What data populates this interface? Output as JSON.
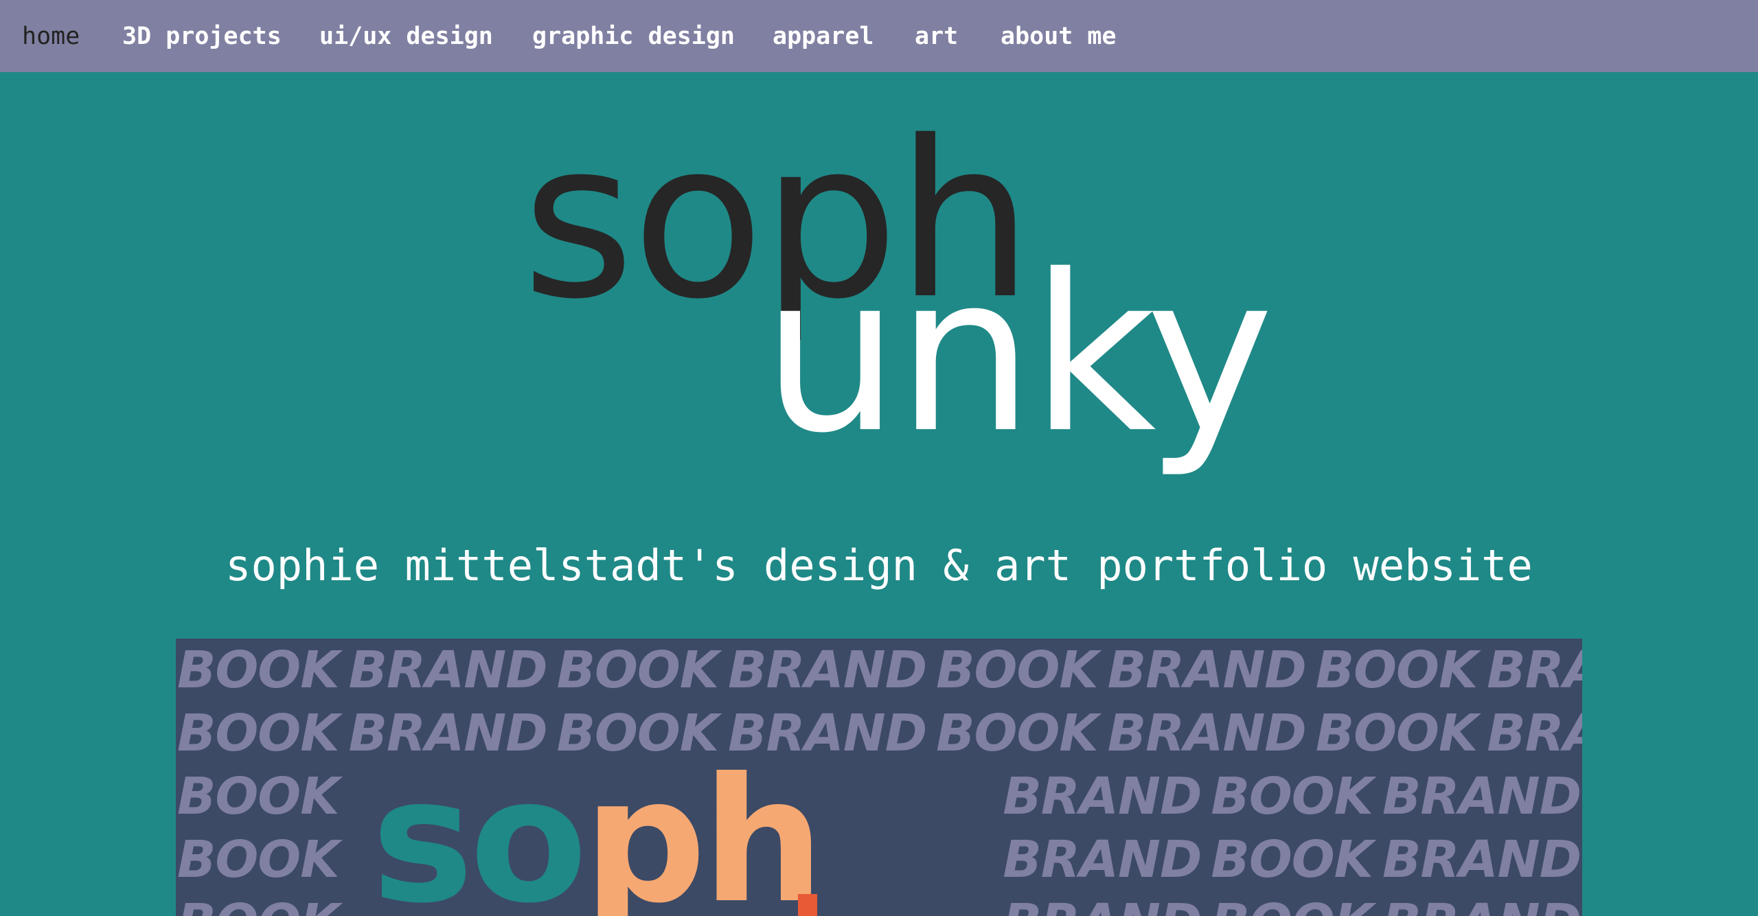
{
  "nav": {
    "items": [
      {
        "label": "home",
        "active": true
      },
      {
        "label": "3D projects"
      },
      {
        "label": "ui/ux design"
      },
      {
        "label": "graphic design"
      },
      {
        "label": "apparel"
      },
      {
        "label": "art"
      },
      {
        "label": "about me"
      }
    ]
  },
  "hero": {
    "logo_top": "soph",
    "logo_bottom": "unky",
    "tagline": "sophie mittelstadt's design & art portfolio website"
  },
  "banner": {
    "word_book": "BOOK",
    "word_brand": "BRAND",
    "brand_logo_so": "so",
    "brand_logo_ph": "ph"
  },
  "colors": {
    "nav_bg": "#8080a2",
    "page_bg": "#1f8987",
    "banner_bg": "#3c4a66",
    "banner_text": "#8080a2",
    "logo_dark": "#262626",
    "accent_orange": "#f6a872",
    "accent_red": "#e85a35"
  }
}
